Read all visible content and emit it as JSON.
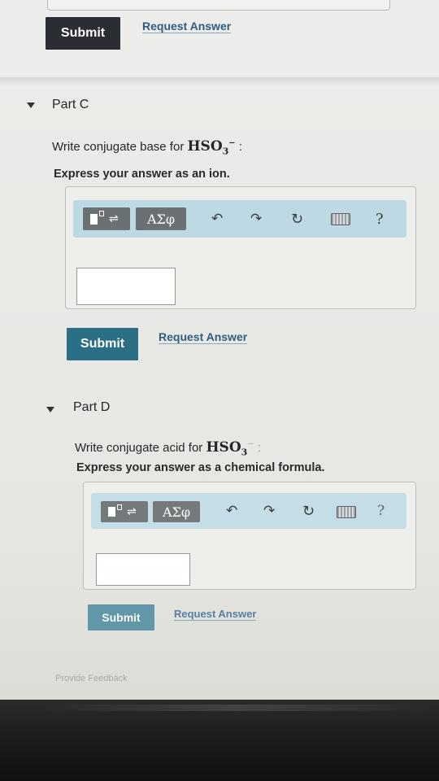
{
  "top": {
    "submit_label": "Submit",
    "request_label": "Request Answer"
  },
  "part_c": {
    "title": "Part C",
    "prompt_before": "Write conjugate base for ",
    "formula_base": "HSO",
    "formula_sub": "3",
    "formula_charge": "−",
    "prompt_after": " :",
    "instruction": "Express your answer as an ion.",
    "toolbar": {
      "templates_icon": "templates-icon",
      "greek_label": "ΑΣφ",
      "undo_icon": "undo-icon",
      "redo_icon": "redo-icon",
      "reset_icon": "reset-icon",
      "keyboard_icon": "keyboard-icon",
      "help_label": "?"
    },
    "submit_label": "Submit",
    "request_label": "Request Answer"
  },
  "part_d": {
    "title": "Part D",
    "prompt_before": "Write conjugate acid for ",
    "formula_base": "HSO",
    "formula_sub": "3",
    "formula_charge": "−",
    "prompt_after": " :",
    "instruction": "Express your answer as a chemical formula.",
    "toolbar": {
      "greek_label": "ΑΣφ",
      "help_label": "?"
    },
    "submit_label": "Submit",
    "request_label": "Request Answer"
  },
  "footer": {
    "feedback_label": "Provide Feedback"
  },
  "colors": {
    "submit_dark": "#2a2e33",
    "submit_teal": "#2a6f86",
    "link": "#2d5e80",
    "toolbar": "#bcd9e4"
  }
}
